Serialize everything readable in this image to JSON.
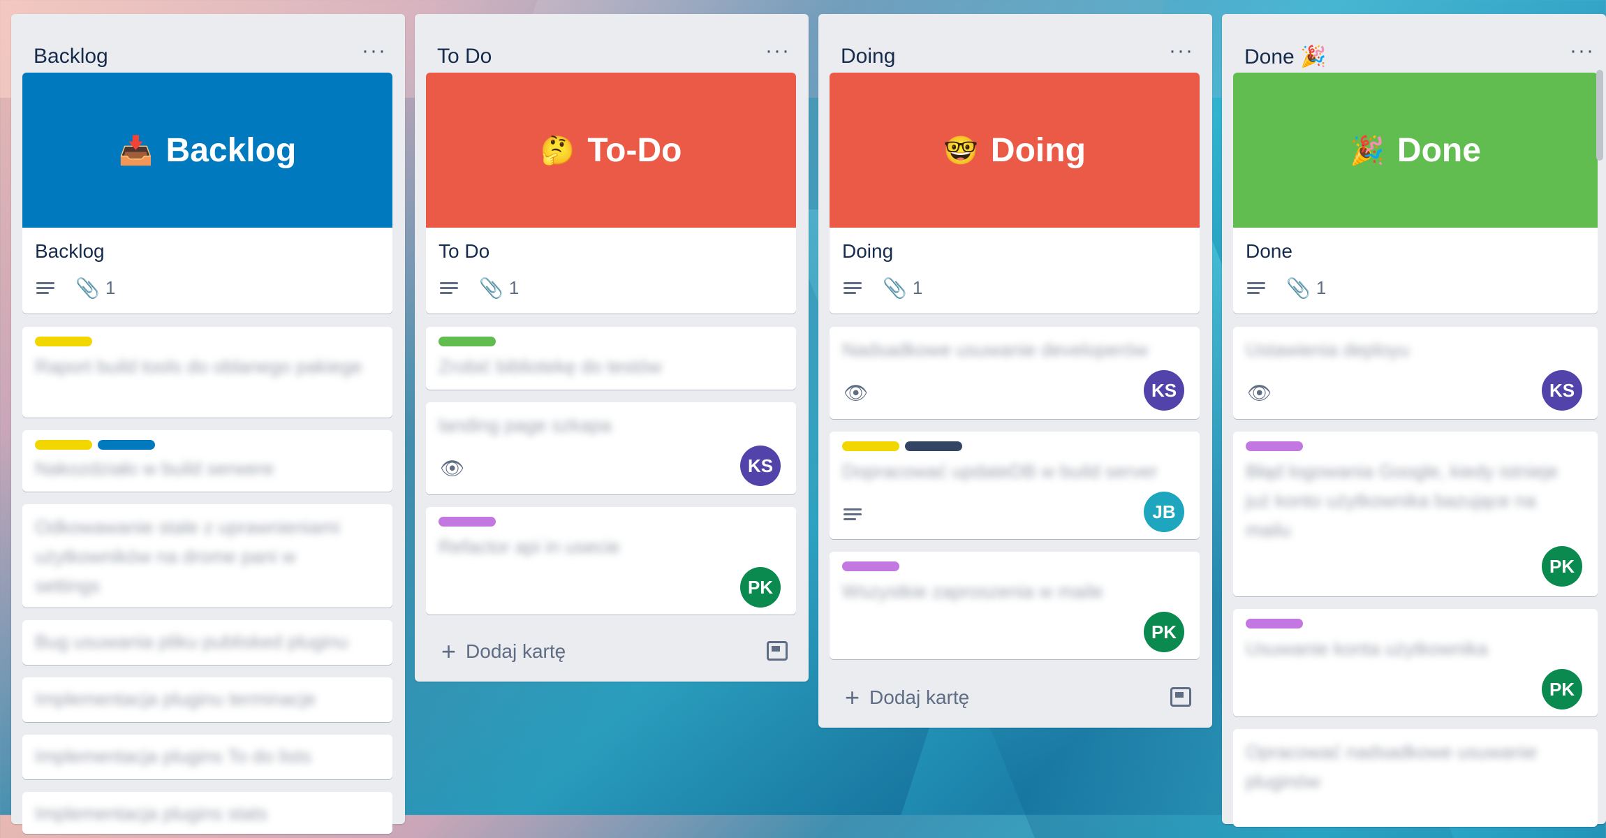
{
  "lists": [
    {
      "title": "Backlog",
      "menu": "···",
      "cover": {
        "emoji": "📥",
        "text": "Backlog",
        "color": "#0079bf"
      },
      "cover_card_title": "Backlog",
      "attachments": "1",
      "cards": [
        "Raport build tools do oblanego pakiege",
        "Nakozdziało w build serwere",
        "Odkowawanie stale z uprawnieniami użytkowników na drome pani w settings",
        "Bug usuwania pliku publisked pluginu",
        "Implementacja pluginu terminacje",
        "Implementacja plugins To do lists",
        "Implementacja plugins stats"
      ]
    },
    {
      "title": "To Do",
      "menu": "···",
      "cover": {
        "emoji": "🤔",
        "text": "To-Do",
        "color": "#eb5a46"
      },
      "cover_card_title": "To Do",
      "attachments": "1",
      "cards": [
        "Zrobić bibliotekę do testów",
        "landing page szkapa",
        "Refactor api in usecie"
      ],
      "avatars": [
        "KS",
        "PK"
      ],
      "add_card": "Dodaj kartę"
    },
    {
      "title": "Doing",
      "menu": "···",
      "cover": {
        "emoji": "🤓",
        "text": "Doing",
        "color": "#eb5a46"
      },
      "cover_card_title": "Doing",
      "attachments": "1",
      "cards": [
        "Nadsadkowe usuwanie developerów",
        "Dopracować updateDB w build server",
        "Wszystkie zaproszenia w maile"
      ],
      "avatars": [
        "KS",
        "JB",
        "PK"
      ],
      "add_card": "Dodaj kartę"
    },
    {
      "title": "Done",
      "title_emoji": "🎉",
      "menu": "···",
      "cover": {
        "emoji": "🎉",
        "text": "Done",
        "color": "#61bd4f"
      },
      "cover_card_title": "Done",
      "attachments": "1",
      "cards": [
        "Ustawienia deployu",
        "Błąd logowania Google, kiedy istnieje już konto użytkownika bazujące na mailu",
        "Usuwanie konta użytkownika",
        "Opracować nadsadkowe usuwanie pluginów"
      ],
      "avatars": [
        "KS",
        "PK",
        "PK"
      ]
    }
  ],
  "colors": {
    "label_yellow": "#f2d600",
    "label_blue": "#0079bf",
    "label_green": "#61bd4f",
    "label_purple": "#c377e0",
    "label_navy": "#344563",
    "avatar_ks": "#5243aa",
    "avatar_pk": "#0a8a4f",
    "avatar_jb": "#1fa6bf"
  }
}
